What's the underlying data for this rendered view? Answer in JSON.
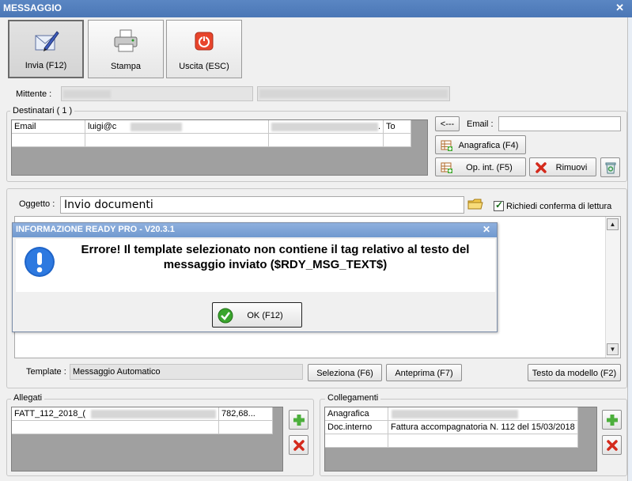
{
  "window": {
    "title": "MESSAGGIO",
    "close_glyph": "✕"
  },
  "toolbar": {
    "send_label": "Invia (F12)",
    "print_label": "Stampa",
    "exit_label": "Uscita (ESC)"
  },
  "sender": {
    "label": "Mittente :"
  },
  "recipients": {
    "title": "Destinatari ( 1 )",
    "row": {
      "type": "Email",
      "address": "luigi@c",
      "mid_marker": ".",
      "mode": "To"
    },
    "back_button": "<---",
    "email_label": "Email :",
    "email_value": "",
    "registry_button": "Anagrafica (F4)",
    "internal_button": "Op. int. (F5)",
    "remove_button": "Rimuovi"
  },
  "message": {
    "subject_label": "Oggetto :",
    "subject_value": "Invio documenti",
    "read_receipt_label": "Richiedi conferma di lettura",
    "read_receipt_checked": true,
    "template_label": "Template :",
    "template_value": "Messaggio Automatico",
    "select_button": "Seleziona (F6)",
    "preview_button": "Anteprima (F7)",
    "model_text_button": "Testo da modello (F2)"
  },
  "dialog": {
    "title": "INFORMAZIONE READY PRO - V20.3.1",
    "close_glyph": "✕",
    "message": "Errore! Il template selezionato non contiene il tag relativo al testo del messaggio inviato ($RDY_MSG_TEXT$)",
    "ok_button": "OK (F12)"
  },
  "attachments": {
    "title": "Allegati",
    "rows": [
      {
        "name": "FATT_112_2018_(",
        "size": "782,68..."
      }
    ]
  },
  "links": {
    "title": "Collegamenti",
    "rows": [
      {
        "type": "Anagrafica",
        "value": ""
      },
      {
        "type": "Doc.interno",
        "value": "Fattura accompagnatoria N. 112 del 15/03/2018"
      }
    ]
  },
  "icons": {
    "send": "quill-pen-icon",
    "print": "printer-icon",
    "exit": "power-icon",
    "info": "exclamation-icon",
    "ok": "checkmark-icon",
    "add": "plus-icon",
    "remove": "red-x-icon",
    "recycle": "recycle-bin-icon",
    "folder": "folder-icon",
    "grid_add": "grid-add-icon"
  },
  "colors": {
    "title_bar": "#4b77b6",
    "dialog_title": "#7099cf",
    "add_green": "#4caf3c",
    "remove_red": "#d42a1c",
    "exit_red": "#e8452c",
    "ok_green": "#3aa52d"
  }
}
